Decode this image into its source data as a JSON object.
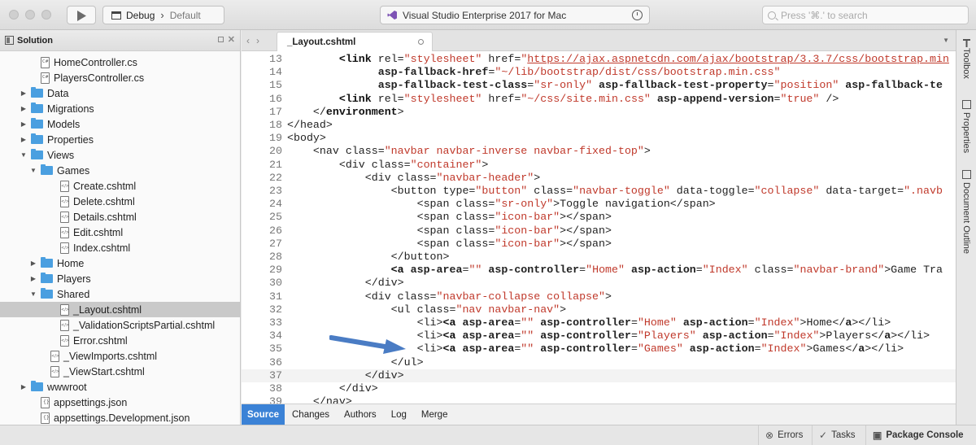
{
  "titlebar": {
    "configuration": "Debug",
    "target": "Default",
    "status_text": "Visual Studio Enterprise 2017 for Mac",
    "search_placeholder": "Press '⌘.' to search"
  },
  "solution_pad": {
    "title": "Solution",
    "items": [
      {
        "label": "HomeController.cs",
        "kind": "cs",
        "depth": 2,
        "arrow": ""
      },
      {
        "label": "PlayersController.cs",
        "kind": "cs",
        "depth": 2,
        "arrow": ""
      },
      {
        "label": "Data",
        "kind": "folder",
        "depth": 1,
        "arrow": "▶"
      },
      {
        "label": "Migrations",
        "kind": "folder",
        "depth": 1,
        "arrow": "▶"
      },
      {
        "label": "Models",
        "kind": "folder",
        "depth": 1,
        "arrow": "▶"
      },
      {
        "label": "Properties",
        "kind": "folder",
        "depth": 1,
        "arrow": "▶"
      },
      {
        "label": "Views",
        "kind": "folder",
        "depth": 1,
        "arrow": "▼"
      },
      {
        "label": "Games",
        "kind": "folder",
        "depth": 2,
        "arrow": "▼"
      },
      {
        "label": "Create.cshtml",
        "kind": "razor",
        "depth": 4,
        "arrow": ""
      },
      {
        "label": "Delete.cshtml",
        "kind": "razor",
        "depth": 4,
        "arrow": ""
      },
      {
        "label": "Details.cshtml",
        "kind": "razor",
        "depth": 4,
        "arrow": ""
      },
      {
        "label": "Edit.cshtml",
        "kind": "razor",
        "depth": 4,
        "arrow": ""
      },
      {
        "label": "Index.cshtml",
        "kind": "razor",
        "depth": 4,
        "arrow": ""
      },
      {
        "label": "Home",
        "kind": "folder",
        "depth": 2,
        "arrow": "▶"
      },
      {
        "label": "Players",
        "kind": "folder",
        "depth": 2,
        "arrow": "▶"
      },
      {
        "label": "Shared",
        "kind": "folder",
        "depth": 2,
        "arrow": "▼"
      },
      {
        "label": "_Layout.cshtml",
        "kind": "razor",
        "depth": 4,
        "arrow": "",
        "selected": true
      },
      {
        "label": "_ValidationScriptsPartial.cshtml",
        "kind": "razor",
        "depth": 4,
        "arrow": ""
      },
      {
        "label": "Error.cshtml",
        "kind": "razor",
        "depth": 4,
        "arrow": ""
      },
      {
        "label": "_ViewImports.cshtml",
        "kind": "razor",
        "depth": 3,
        "arrow": ""
      },
      {
        "label": "_ViewStart.cshtml",
        "kind": "razor",
        "depth": 3,
        "arrow": ""
      },
      {
        "label": "wwwroot",
        "kind": "folder",
        "depth": 1,
        "arrow": "▶"
      },
      {
        "label": "appsettings.json",
        "kind": "json",
        "depth": 2,
        "arrow": ""
      },
      {
        "label": "appsettings.Development.json",
        "kind": "json",
        "depth": 2,
        "arrow": ""
      }
    ]
  },
  "editor": {
    "tab_label": "_Layout.cshtml",
    "current_line": 37,
    "lines": [
      {
        "n": "13",
        "html": "        <span class='tag'>&lt;link</span> rel=<span class='str'>\"stylesheet\"</span> href=<span class='str'>\"</span><span class='url'>https://ajax.aspnetcdn.com/ajax/bootstrap/3.3.7/css/bootstrap.min</span>"
      },
      {
        "n": "14",
        "html": "              <b>asp-fallback-href</b>=<span class='str'>\"~/lib/bootstrap/dist/css/bootstrap.min.css\"</span>"
      },
      {
        "n": "15",
        "html": "              <b>asp-fallback-test-class</b>=<span class='str'>\"sr-only\"</span> <b>asp-fallback-test-property</b>=<span class='str'>\"position\"</span> <b>asp-fallback-te</b>"
      },
      {
        "n": "16",
        "html": "        <span class='tag'>&lt;link</span> rel=<span class='str'>\"stylesheet\"</span> href=<span class='str'>\"~/css/site.min.css\"</span> <b>asp-append-version</b>=<span class='str'>\"true\"</span> /&gt;"
      },
      {
        "n": "17",
        "html": "    &lt;/<span class='tag'>environment</span>&gt;"
      },
      {
        "n": "18",
        "html": "&lt;/head&gt;"
      },
      {
        "n": "19",
        "html": "&lt;body&gt;"
      },
      {
        "n": "20",
        "html": "    &lt;nav class=<span class='str'>\"navbar navbar-inverse navbar-fixed-top\"</span>&gt;"
      },
      {
        "n": "21",
        "html": "        &lt;div class=<span class='str'>\"container\"</span>&gt;"
      },
      {
        "n": "22",
        "html": "            &lt;div class=<span class='str'>\"navbar-header\"</span>&gt;"
      },
      {
        "n": "23",
        "html": "                &lt;button type=<span class='str'>\"button\"</span> class=<span class='str'>\"navbar-toggle\"</span> data-toggle=<span class='str'>\"collapse\"</span> data-target=<span class='str'>\".navb</span>"
      },
      {
        "n": "24",
        "html": "                    &lt;span class=<span class='str'>\"sr-only\"</span>&gt;Toggle navigation&lt;/span&gt;"
      },
      {
        "n": "25",
        "html": "                    &lt;span class=<span class='str'>\"icon-bar\"</span>&gt;&lt;/span&gt;"
      },
      {
        "n": "26",
        "html": "                    &lt;span class=<span class='str'>\"icon-bar\"</span>&gt;&lt;/span&gt;"
      },
      {
        "n": "27",
        "html": "                    &lt;span class=<span class='str'>\"icon-bar\"</span>&gt;&lt;/span&gt;"
      },
      {
        "n": "28",
        "html": "                &lt;/button&gt;"
      },
      {
        "n": "29",
        "html": "                <span class='tag'>&lt;a</span> <b>asp-area</b>=<span class='str'>\"\"</span> <b>asp-controller</b>=<span class='str'>\"Home\"</span> <b>asp-action</b>=<span class='str'>\"Index\"</span> class=<span class='str'>\"navbar-brand\"</span>&gt;Game Tra"
      },
      {
        "n": "30",
        "html": "            &lt;/div&gt;"
      },
      {
        "n": "31",
        "html": "            &lt;div class=<span class='str'>\"navbar-collapse collapse\"</span>&gt;"
      },
      {
        "n": "32",
        "html": "                &lt;ul class=<span class='str'>\"nav navbar-nav\"</span>&gt;"
      },
      {
        "n": "33",
        "html": "                    &lt;li&gt;<span class='tag'>&lt;a</span> <b>asp-area</b>=<span class='str'>\"\"</span> <b>asp-controller</b>=<span class='str'>\"Home\"</span> <b>asp-action</b>=<span class='str'>\"Index\"</span>&gt;Home&lt;/<b>a</b>&gt;&lt;/li&gt;"
      },
      {
        "n": "34",
        "html": "                    &lt;li&gt;<span class='tag'>&lt;a</span> <b>asp-area</b>=<span class='str'>\"\"</span> <b>asp-controller</b>=<span class='str'>\"Players\"</span> <b>asp-action</b>=<span class='str'>\"Index\"</span>&gt;Players&lt;/<b>a</b>&gt;&lt;/li&gt;"
      },
      {
        "n": "35",
        "html": "                    &lt;li&gt;<span class='tag'>&lt;a</span> <b>asp-area</b>=<span class='str'>\"\"</span> <b>asp-controller</b>=<span class='str'>\"Games\"</span> <b>asp-action</b>=<span class='str'>\"Index\"</span>&gt;Games&lt;/<b>a</b>&gt;&lt;/li&gt;"
      },
      {
        "n": "36",
        "html": "                &lt;/ul&gt;"
      },
      {
        "n": "37",
        "html": "            &lt;/div&gt;"
      },
      {
        "n": "38",
        "html": "        &lt;/div&gt;"
      },
      {
        "n": "39",
        "html": "    &lt;/nav&gt;"
      }
    ],
    "bottom_tabs": [
      "Source",
      "Changes",
      "Authors",
      "Log",
      "Merge"
    ],
    "active_bottom_tab": "Source",
    "accent_color": "#3b82d6",
    "annotation_arrow_color": "#4a7cc4"
  },
  "right_pads": [
    "Toolbox",
    "Properties",
    "Document Outline"
  ],
  "statusbar": {
    "errors": "Errors",
    "tasks": "Tasks",
    "package_console": "Package Console"
  }
}
